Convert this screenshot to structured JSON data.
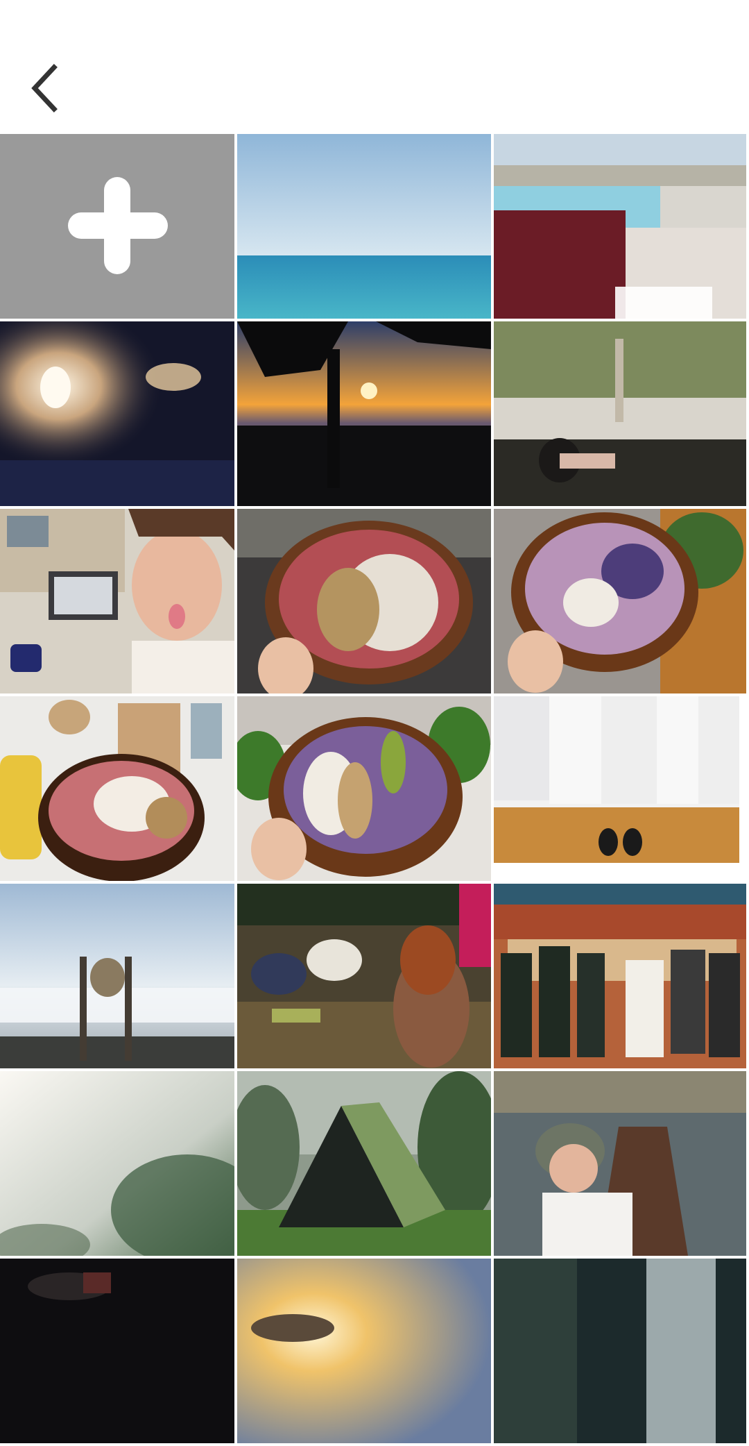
{
  "header": {
    "back_icon": "chevron-left-icon"
  },
  "grid": {
    "add_tile": {
      "icon": "plus-icon",
      "background": "#9a9a9a"
    },
    "photos": [
      {
        "name": "photo-ocean-horizon",
        "icon": "image-thumbnail"
      },
      {
        "name": "photo-pool-laptop",
        "icon": "image-thumbnail"
      },
      {
        "name": "photo-airplane-cabin",
        "icon": "image-thumbnail"
      },
      {
        "name": "photo-beach-sunset",
        "icon": "image-thumbnail"
      },
      {
        "name": "photo-woman-pool-rocks",
        "icon": "image-thumbnail"
      },
      {
        "name": "photo-selfie-tongue-laptop",
        "icon": "image-thumbnail"
      },
      {
        "name": "photo-smoothie-bowl-red",
        "icon": "image-thumbnail"
      },
      {
        "name": "photo-smoothie-bowl-purple",
        "icon": "image-thumbnail"
      },
      {
        "name": "photo-smoothie-bowl-candle",
        "icon": "image-thumbnail"
      },
      {
        "name": "photo-smoothie-bowl-kiwi",
        "icon": "image-thumbnail"
      },
      {
        "name": "photo-brochure-sneakers",
        "icon": "image-thumbnail"
      },
      {
        "name": "photo-sign-above-clouds",
        "icon": "image-thumbnail"
      },
      {
        "name": "photo-festival-crowd",
        "icon": "image-thumbnail"
      },
      {
        "name": "photo-dancers-village",
        "icon": "image-thumbnail"
      },
      {
        "name": "photo-misty-forest",
        "icon": "image-thumbnail"
      },
      {
        "name": "photo-a-frame-hut",
        "icon": "image-thumbnail"
      },
      {
        "name": "photo-woman-canoe",
        "icon": "image-thumbnail"
      },
      {
        "name": "photo-dark-car",
        "icon": "image-thumbnail"
      },
      {
        "name": "photo-sunset-jeep",
        "icon": "image-thumbnail"
      },
      {
        "name": "photo-waterfall",
        "icon": "image-thumbnail"
      }
    ]
  }
}
